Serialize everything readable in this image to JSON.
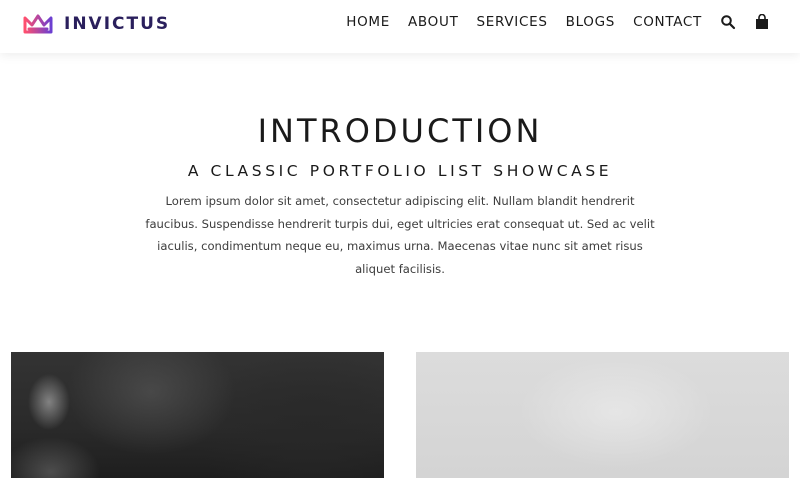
{
  "brand": {
    "name": "INVICTUS",
    "colors": {
      "logo_start": "#ff4f6e",
      "logo_end": "#6b3fd1",
      "text": "#2a1f5c"
    }
  },
  "nav": {
    "items": [
      "HOME",
      "ABOUT",
      "SERVICES",
      "BLOGS",
      "CONTACT"
    ],
    "icons": [
      "search-icon",
      "shopping-bag-icon"
    ]
  },
  "intro": {
    "title": "INTRODUCTION",
    "subtitle": "A CLASSIC PORTFOLIO LIST SHOWCASE",
    "body": "Lorem ipsum dolor sit amet, consectetur adipiscing elit. Nullam blandit hendrerit faucibus. Suspendisse hendrerit turpis dui, eget ultricies erat consequat ut. Sed ac velit iaculis, condimentum neque eu, maximus urna. Maecenas vitae nunc sit amet risus aliquet facilisis."
  },
  "portfolio": {
    "items": [
      {
        "tone": "dark"
      },
      {
        "tone": "light"
      }
    ]
  }
}
